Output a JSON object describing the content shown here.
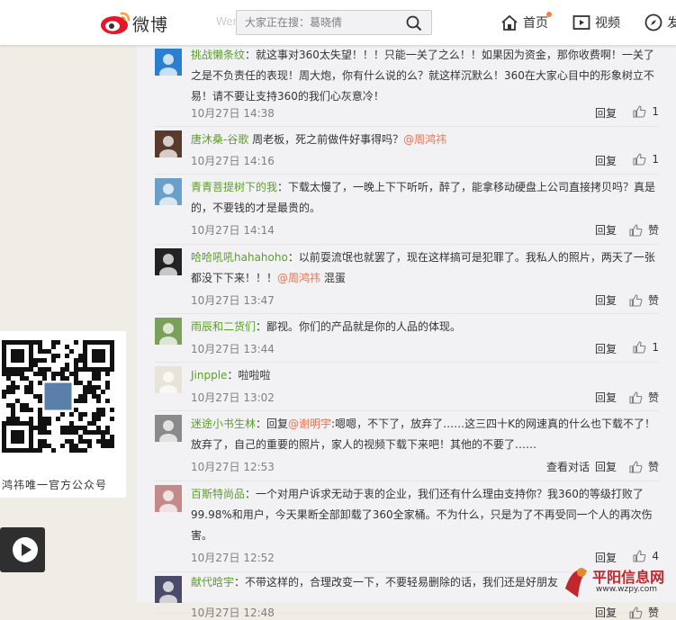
{
  "header": {
    "logo_text": "微博",
    "faded_text": "Wen Hao",
    "search_placeholder": "大家正在搜：葛晓倩",
    "nav_home": "首页",
    "nav_video": "视频",
    "nav_discover": "发"
  },
  "side": {
    "qr_caption": "鸿祎唯一官方公众号"
  },
  "labels": {
    "reply": "回复",
    "view_conversation": "查看对话",
    "like_zero": "赞"
  },
  "comments": [
    {
      "user": "挑战懒条纹",
      "text": "：就这事对360太失望！！！只能一关了之么！！如果因为资金，那你收费啊！一关了之是不负责任的表现！周大炮，你有什么说的么？就这样沉默么！360在大家心目中的形象树立不易！请不要让支持360的我们心灰意冷！",
      "time": "10月27日 14:38",
      "likes": "1"
    },
    {
      "user": "唐沐桑-谷歌",
      "at": "@周鸿祎",
      "text": " 周老板，死之前做件好事得吗？",
      "time": "10月27日 14:16",
      "likes": "1"
    },
    {
      "user": "青青菩提树下的我",
      "text": "：下载太慢了，一晚上下下听听，醉了，能拿移动硬盘上公司直接拷贝吗？真是的，不要钱的才是最贵的。",
      "time": "10月27日 14:14",
      "likes": "赞"
    },
    {
      "user": "哈哈吼吼hahahoho",
      "text": "：以前耍流氓也就罢了，现在这样搞可是犯罪了。我私人的照片，两天了一张都没下下来！！！",
      "at": "@周鸿祎",
      "text2": " 混蛋",
      "time": "10月27日 13:47",
      "likes": "赞"
    },
    {
      "user": "雨辰和二货们",
      "text": "：鄙视。你们的产品就是你的人品的体现。",
      "time": "10月27日 13:44",
      "likes": "1"
    },
    {
      "user": "Jinpple",
      "text": "：啦啦啦",
      "time": "10月27日 13:02",
      "likes": "赞"
    },
    {
      "user": "迷途小书生林",
      "text": "：回复",
      "at": "@谢明宇",
      "text2": ":嗯嗯，不下了，放弃了……这三四十K的网速真的什么也下载不了！放弃了，自己的重要的照片，家人的视频下载下来吧！其他的不要了……",
      "time": "10月27日 12:53",
      "likes": "赞",
      "view_conversation": true
    },
    {
      "user": "百斯特尚品",
      "text": "：一个对用户诉求无动于衷的企业，我们还有什么理由支持你？我360的等级打败了99.98%和用户，今天果断全部卸载了360全家桶。不为什么，只是为了不再受同一个人的再次伤害。",
      "time": "10月27日 12:52",
      "likes": "4"
    },
    {
      "user": "献代晗宇",
      "text": "：不带这样的，合理改变一下，不要轻易删除的话，我们还是好朋友",
      "time": "10月27日 12:48",
      "likes": "赞"
    }
  ],
  "watermark": {
    "name": "平阳信息网",
    "url": "www.wzpy.com"
  },
  "colors": {
    "username": "#5d9d2b",
    "mention": "#eb7350",
    "accent": "#fa7d3c"
  }
}
